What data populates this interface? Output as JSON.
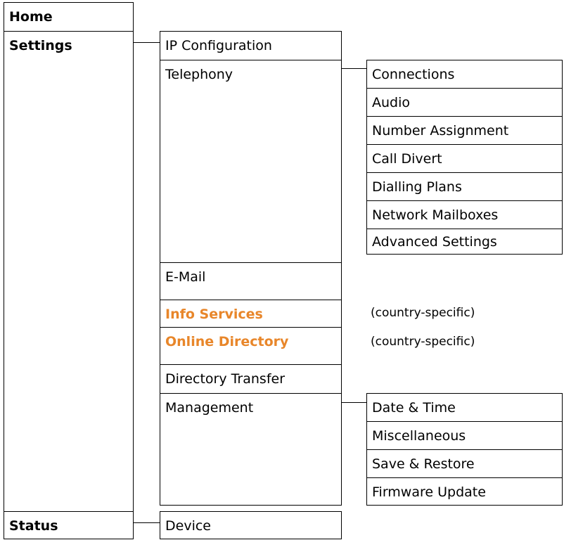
{
  "level1": {
    "home": "Home",
    "settings": "Settings",
    "status": "Status"
  },
  "settings_items": {
    "ip_configuration": "IP Configuration",
    "telephony": "Telephony",
    "email": "E-Mail",
    "info_services": "Info Services",
    "online_directory": "Online Directory",
    "directory_transfer": "Directory Transfer",
    "management": "Management"
  },
  "telephony_items": [
    "Connections",
    "Audio",
    "Number Assignment",
    "Call Divert",
    "Dialling Plans",
    "Network Mailboxes",
    "Advanced Settings"
  ],
  "management_items": [
    "Date & Time",
    "Miscellaneous",
    "Save & Restore",
    "Firmware Update"
  ],
  "status_items": {
    "device": "Device"
  },
  "notes": {
    "info_services": "(country-specific)",
    "online_directory": "(country-specific)"
  },
  "colors": {
    "highlight": "#e8862a"
  }
}
